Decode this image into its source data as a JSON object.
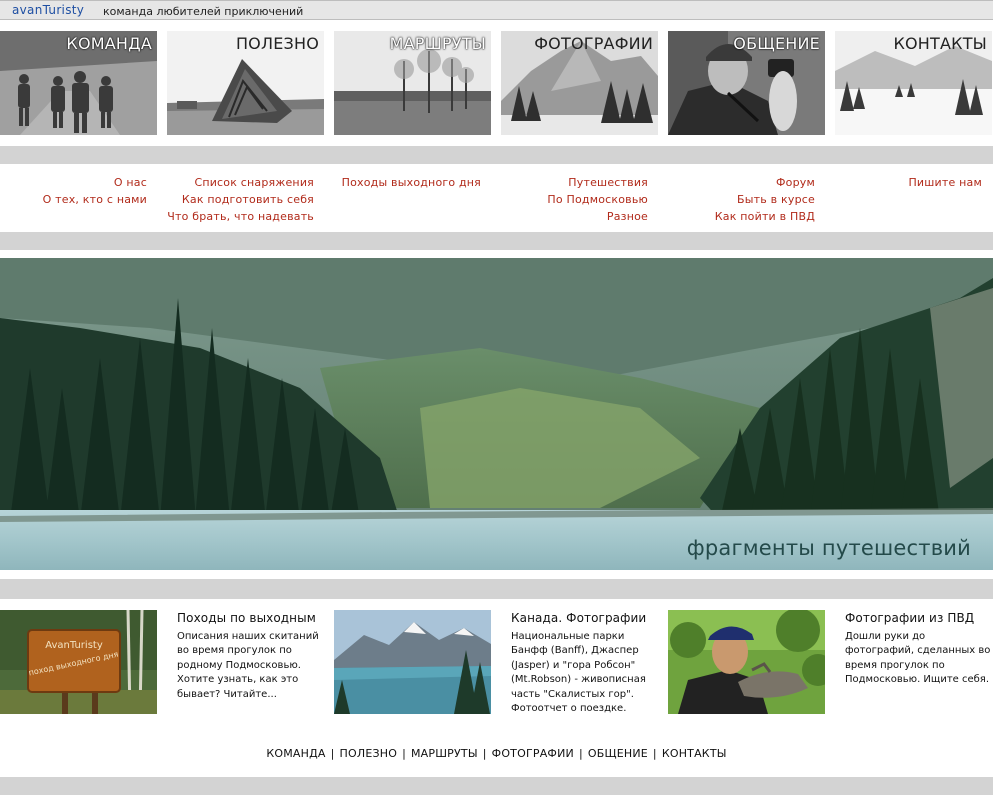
{
  "header": {
    "logo": "avanTuristy",
    "tagline": "команда любителей приключений"
  },
  "nav": [
    {
      "label": "КОМАНДА",
      "links": [
        "О нас",
        "О тех, кто с нами"
      ]
    },
    {
      "label": "ПОЛЕЗНО",
      "links": [
        "Список снаряжения",
        "Как подготовить себя",
        "Что брать, что надевать"
      ]
    },
    {
      "label": "МАРШРУТЫ",
      "links": [
        "Походы выходного дня"
      ]
    },
    {
      "label": "ФОТОГРАФИИ",
      "links": [
        "Путешествия",
        "По Подмосковью",
        "Разное"
      ]
    },
    {
      "label": "ОБЩЕНИЕ",
      "links": [
        "Форум",
        "Быть в курсе",
        "Как пойти в ПВД"
      ]
    },
    {
      "label": "КОНТАКТЫ",
      "links": [
        "Пишите нам"
      ]
    }
  ],
  "hero": {
    "caption": "фрагменты путешествий"
  },
  "features": [
    {
      "title": "Походы по выходным",
      "text": "Описания наших скитаний во время прогулок по родному Подмосковью. Хотите узнать, как это бывает? Читайте...",
      "sign_line1": "AvanTuristy",
      "sign_line2": "поход выходного дня"
    },
    {
      "title": "Канада. Фотографии",
      "text": "Национальные парки Банфф (Banff), Джаспер (Jasper) и \"гора Робсон\" (Mt.Robson) - живописная часть \"Скалистых гор\". Фотоотчет о поездке."
    },
    {
      "title": "Фотографии из ПВД",
      "text": "Дошли руки до фотографий, сделанных во время прогулок по Подмосковью. Ищите себя."
    }
  ],
  "footer": {
    "links": [
      "КОМАНДА",
      "ПОЛЕЗНО",
      "МАРШРУТЫ",
      "ФОТОГРАФИИ",
      "ОБЩЕНИЕ",
      "КОНТАКТЫ"
    ],
    "separator": "|"
  }
}
